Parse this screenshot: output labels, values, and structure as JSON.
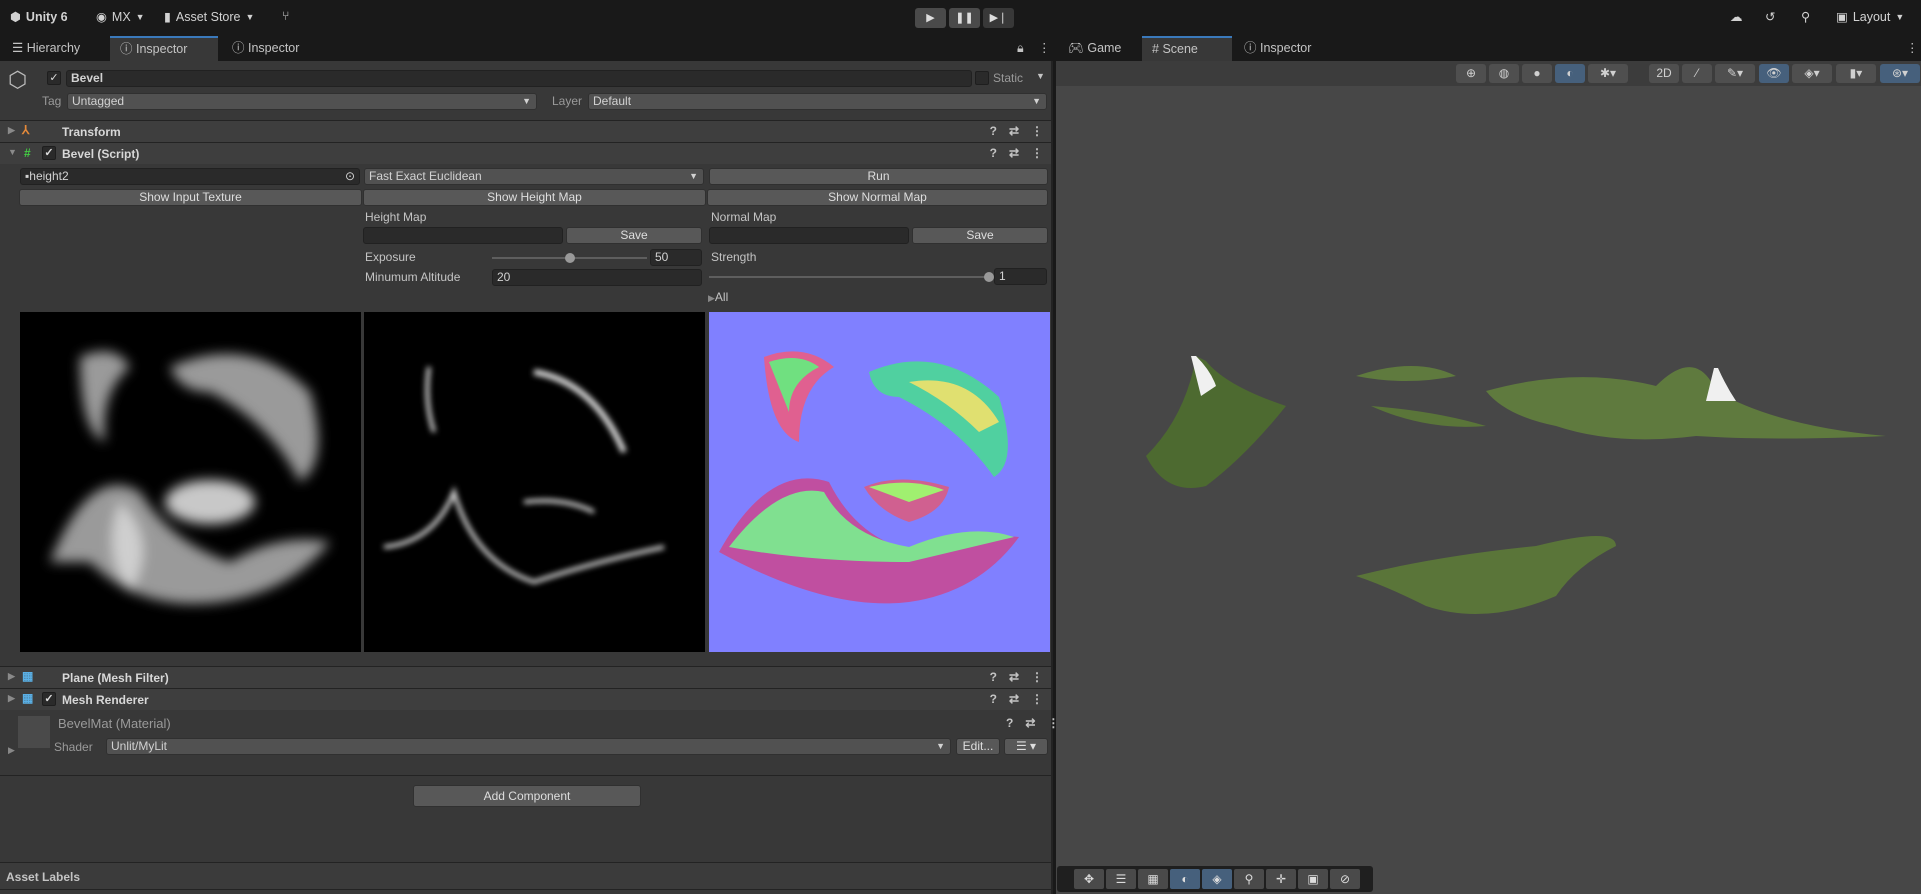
{
  "toolbar": {
    "app": "Unity 6",
    "account": "MX",
    "asset_store": "Asset Store",
    "layout": "Layout"
  },
  "left_tabs": [
    "Hierarchy",
    "Inspector",
    "Inspector"
  ],
  "right_tabs": [
    "Game",
    "Scene",
    "Inspector"
  ],
  "object": {
    "name": "Bevel",
    "enabled": true,
    "static_label": "Static",
    "tag_label": "Tag",
    "tag": "Untagged",
    "layer_label": "Layer",
    "layer": "Default"
  },
  "components": {
    "transform": "Transform",
    "bevel_script": "Bevel (Script)",
    "mesh_filter": "Plane (Mesh Filter)",
    "mesh_renderer": "Mesh Renderer"
  },
  "bevel": {
    "texture": "height2",
    "algorithm": "Fast Exact Euclidean",
    "run": "Run",
    "show_input": "Show Input Texture",
    "show_height": "Show Height Map",
    "show_normal": "Show Normal Map",
    "height_map_label": "Height Map",
    "normal_map_label": "Normal Map",
    "save": "Save",
    "exposure_label": "Exposure",
    "exposure": "50",
    "exposure_fraction": 0.5,
    "min_alt_label": "Minumum Altitude",
    "min_alt": "20",
    "strength_label": "Strength",
    "strength": "1",
    "strength_fraction": 1.0,
    "all": "All"
  },
  "material": {
    "name": "BevelMat (Material)",
    "shader_label": "Shader",
    "shader": "Unlit/MyLit",
    "edit": "Edit..."
  },
  "add_component": "Add Component",
  "asset_labels": "Asset Labels",
  "colors": {
    "accent": "#3a79bb",
    "selected": "#46607c",
    "normal_bg": "#8080ff",
    "terrain": "#5f7a3e",
    "scene_bg": "#474747"
  }
}
